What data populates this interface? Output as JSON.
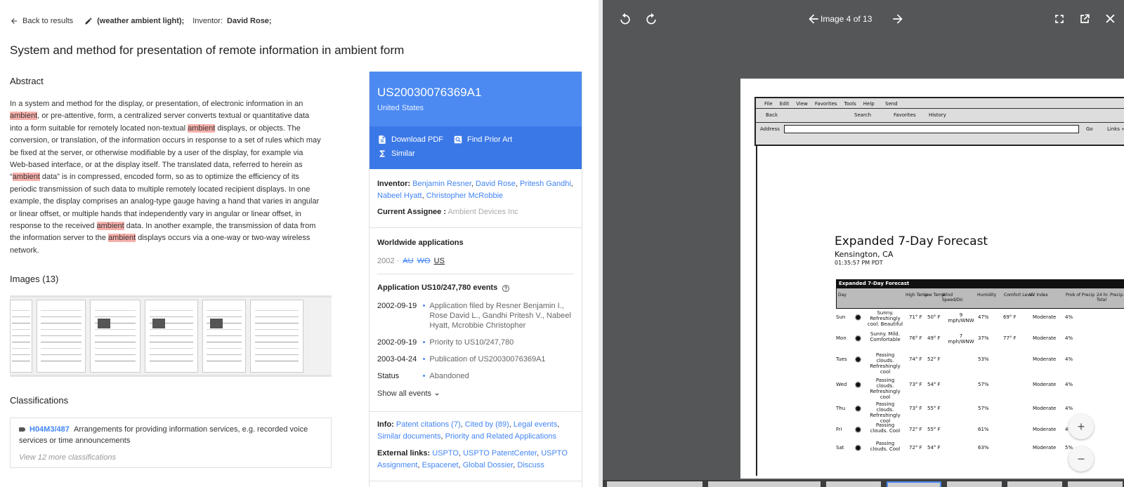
{
  "topbar": {
    "back_label": "Back to results",
    "query_prefix": "(weather ambient light);",
    "inventor_label": "Inventor:",
    "inventor_value": "David Rose;"
  },
  "title": "System and method for presentation of remote information in ambient form",
  "abstract": {
    "heading": "Abstract",
    "segments": [
      {
        "t": "In a system and method for the display, or presentation, of electronic information in an ",
        "h": false
      },
      {
        "t": "ambient",
        "h": true
      },
      {
        "t": ", or pre-attentive, form, a centralized server converts textual or quantitative data into a form suitable for remotely located non-textual ",
        "h": false
      },
      {
        "t": "ambient",
        "h": true
      },
      {
        "t": " displays, or objects. The conversion, or translation, of the information occurs in response to a set of rules which may be fixed at the server, or otherwise modifiable by a user of the display, for example via Web-based interface, or at the display itself. The translated data, referred to herein as “",
        "h": false
      },
      {
        "t": "ambient",
        "h": true
      },
      {
        "t": " data” is in compressed, encoded form, so as to optimize the efficiency of its periodic transmission of such data to multiple remotely located recipient displays. In one example, the display comprises an analog-type gauge having a hand that varies in angular or linear offset, or multiple hands that independently vary in angular or linear offset, in response to the received ",
        "h": false
      },
      {
        "t": "ambient",
        "h": true
      },
      {
        "t": " data. In another example, the transmission of data from the information server to the ",
        "h": false
      },
      {
        "t": "ambient",
        "h": true
      },
      {
        "t": " displays occurs via a one-way or two-way wireless network.",
        "h": false
      }
    ]
  },
  "images": {
    "heading": "Images (13)"
  },
  "classifications": {
    "heading": "Classifications",
    "code": "H04M3/487",
    "description": "Arrangements for providing information services, e.g. recorded voice services or time announcements",
    "more": "View 12 more classifications"
  },
  "card": {
    "number": "US20030076369A1",
    "country": "United States",
    "download": "Download PDF",
    "prior_art": "Find Prior Art",
    "similar": "Similar",
    "inventor_label": "Inventor:",
    "inventors": [
      "Benjamin Resner",
      "David Rose",
      "Pritesh Gandhi",
      "Nabeel Hyatt",
      "Christopher McRobbie"
    ],
    "assignee_label": "Current Assignee :",
    "assignee": "Ambient Devices Inc",
    "worldwide_heading": "Worldwide applications",
    "ww_year": "2002",
    "ww_sep": "·",
    "ww_codes": [
      "AU",
      "WO"
    ],
    "ww_current": "US",
    "events_heading": "Application US10/247,780 events",
    "events": [
      {
        "date": "2002-09-19",
        "text": "Application filed by Resner Benjamin I., Rose David L., Gandhi Pritesh V., Nabeel Hyatt, Mcrobbie Christopher"
      },
      {
        "date": "2002-09-19",
        "text": "Priority to US10/247,780"
      },
      {
        "date": "2003-04-24",
        "text": "Publication of US20030076369A1"
      },
      {
        "date": "Status",
        "text": "Abandoned"
      }
    ],
    "show_all": "Show all events",
    "info_label": "Info:",
    "info_links": [
      "Patent citations (7)",
      "Cited by (89)",
      "Legal events",
      "Similar documents",
      "Priority and Related Applications"
    ],
    "ext_label": "External links:",
    "ext_links": [
      "USPTO",
      "USPTO PatentCenter",
      "USPTO Assignment",
      "Espacenet",
      "Global Dossier",
      "Discuss"
    ]
  },
  "viewer": {
    "counter": "Image 4 of 13",
    "page": {
      "menu": [
        "File",
        "Edit",
        "View",
        "Favorites",
        "Tools",
        "Help"
      ],
      "send": "Send",
      "address": "Address",
      "go": "Go",
      "links": "Links »",
      "back": "Back",
      "search": "Search",
      "favorites": "Favorites",
      "history": "History",
      "heading": "Expanded 7-Day Forecast",
      "location": "Kensington, CA",
      "time": "01:35:57 PM PDT",
      "table_title": "Expanded 7-Day Forecast",
      "columns": [
        "Day",
        "High Temp",
        "Low Temp",
        "Wind Speed/Dir.",
        "Humidity",
        "Comfort Level",
        "UV Index",
        "Prob of Precip",
        "24 hr. Precip. Total"
      ],
      "rows": [
        {
          "day": "Sun",
          "desc": "Sunny. Refreshingly cool. Beautiful",
          "hi": "71° F",
          "lo": "50° F",
          "wind": "9 mph/WNW",
          "hum": "47%",
          "comfort": "69° F",
          "uv": "Moderate",
          "prob": "4%"
        },
        {
          "day": "Mon",
          "desc": "Sunny. Mild. Comfortable",
          "hi": "76° F",
          "lo": "49° F",
          "wind": "7 mph/WNW",
          "hum": "37%",
          "comfort": "77° F",
          "uv": "Moderate",
          "prob": "4%"
        },
        {
          "day": "Tues",
          "desc": "Passing clouds. Refreshingly cool",
          "hi": "74° F",
          "lo": "52° F",
          "wind": "",
          "hum": "53%",
          "comfort": "",
          "uv": "Moderate",
          "prob": "4%"
        },
        {
          "day": "Wed",
          "desc": "Passing clouds. Refreshingly cool",
          "hi": "73° F",
          "lo": "54° F",
          "wind": "",
          "hum": "57%",
          "comfort": "",
          "uv": "Moderate",
          "prob": "4%"
        },
        {
          "day": "Thu",
          "desc": "Passing clouds. Refreshingly cool",
          "hi": "73° F",
          "lo": "55° F",
          "wind": "",
          "hum": "57%",
          "comfort": "",
          "uv": "Moderate",
          "prob": "4%"
        },
        {
          "day": "Fri",
          "desc": "Passing clouds. Cool",
          "hi": "72° F",
          "lo": "55° F",
          "wind": "",
          "hum": "61%",
          "comfort": "",
          "uv": "Moderate",
          "prob": "4%"
        },
        {
          "day": "Sat",
          "desc": "Passing clouds. Cool",
          "hi": "72° F",
          "lo": "54° F",
          "wind": "",
          "hum": "63%",
          "comfort": "",
          "uv": "Moderate",
          "prob": "5%"
        }
      ]
    }
  },
  "colors": {
    "accent": "#4285f4",
    "card_blue": "#4c8af2",
    "card_blue_dark": "#3b78e7",
    "highlight": "#f8b1ac",
    "viewer_bg": "#545657"
  }
}
